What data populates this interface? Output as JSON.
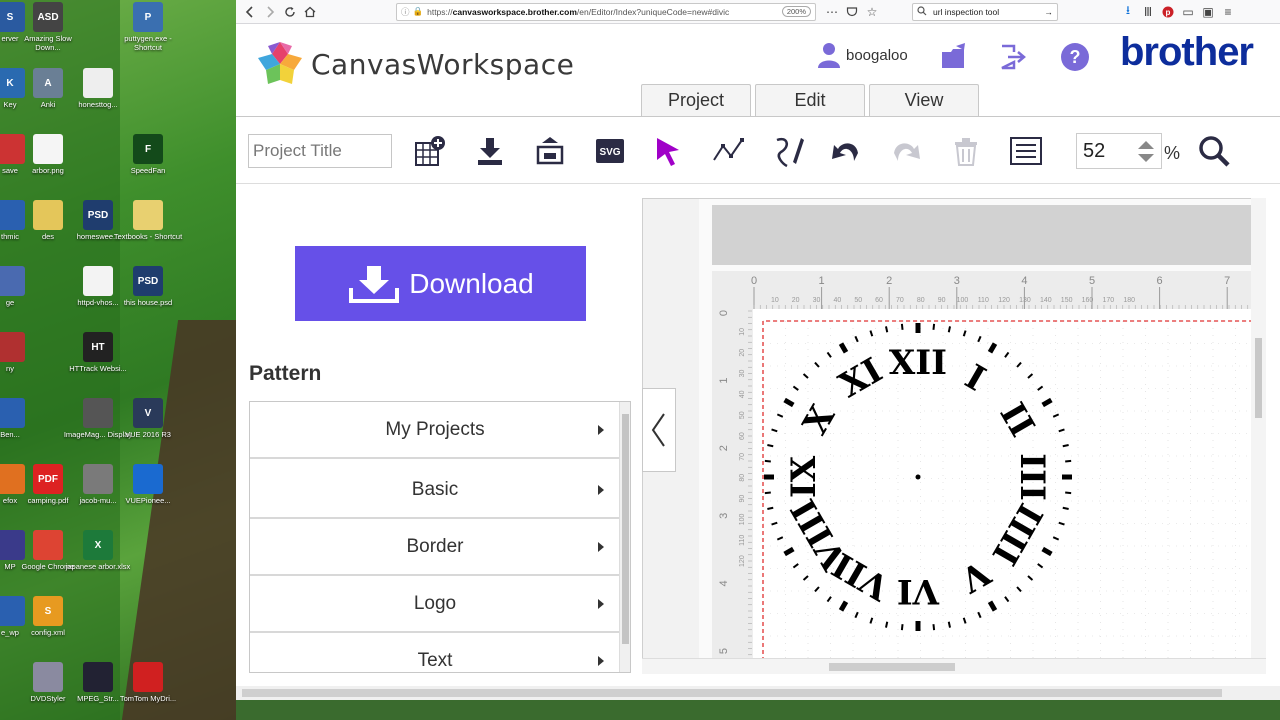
{
  "desktop": {
    "icons": [
      {
        "label": "erver",
        "color": "#2a5aa0",
        "glyph": "S"
      },
      {
        "label": "Amazing Slow Down...",
        "color": "#444",
        "glyph": "ASD"
      },
      {
        "label": "puttygen.exe - Shortcut",
        "color": "#3a6fb0",
        "glyph": "P"
      },
      {
        "label": "Key",
        "color": "#2a6ab0",
        "glyph": "K"
      },
      {
        "label": "Anki",
        "color": "#6a7f95",
        "glyph": "A"
      },
      {
        "label": "honesttog...",
        "color": "#eee",
        "glyph": ""
      },
      {
        "label": "save",
        "color": "#c33",
        "glyph": ""
      },
      {
        "label": "arbor.png",
        "color": "#f5f5f5",
        "glyph": ""
      },
      {
        "label": "SpeedFan",
        "color": "#134a1a",
        "glyph": "F"
      },
      {
        "label": "thmic",
        "color": "#2a60b0",
        "glyph": ""
      },
      {
        "label": "des",
        "color": "#e4c65a",
        "glyph": ""
      },
      {
        "label": "homeswee...",
        "color": "#1f3d6e",
        "glyph": "PSD"
      },
      {
        "label": "Textbooks - Shortcut",
        "color": "#e8d070",
        "glyph": ""
      },
      {
        "label": "ge",
        "color": "#4a6ab0",
        "glyph": ""
      },
      {
        "label": "httpd-vhos...",
        "color": "#f3f3f3",
        "glyph": ""
      },
      {
        "label": "this house.psd",
        "color": "#1f3d6e",
        "glyph": "PSD"
      },
      {
        "label": "ny",
        "color": "#b03030",
        "glyph": ""
      },
      {
        "label": "HTTrack Websi...",
        "color": "#222",
        "glyph": "HT"
      },
      {
        "label": "Ben...",
        "color": "#2a60b0",
        "glyph": ""
      },
      {
        "label": "ImageMag... Display",
        "color": "#555",
        "glyph": ""
      },
      {
        "label": "VUE 2016 R3",
        "color": "#2a3a5a",
        "glyph": "V"
      },
      {
        "label": "efox",
        "color": "#e07020",
        "glyph": ""
      },
      {
        "label": "camping.pdf",
        "color": "#d22",
        "glyph": "PDF"
      },
      {
        "label": "jacob-mu...",
        "color": "#7a7a7a",
        "glyph": ""
      },
      {
        "label": "VUEPionee...",
        "color": "#1a6ad0",
        "glyph": ""
      },
      {
        "label": "MP",
        "color": "#3a3a8a",
        "glyph": ""
      },
      {
        "label": "Google Chrome",
        "color": "#dd4433",
        "glyph": ""
      },
      {
        "label": "japanese arbor.xlsx",
        "color": "#1d7a3a",
        "glyph": "X"
      },
      {
        "label": "e_wp",
        "color": "#2a60b0",
        "glyph": ""
      },
      {
        "label": "config.xml",
        "color": "#e79a20",
        "glyph": "S"
      },
      {
        "label": "DVDStyler",
        "color": "#8a8aa0",
        "glyph": ""
      },
      {
        "label": "MPEG_Str...",
        "color": "#223",
        "glyph": ""
      },
      {
        "label": "TomTom MyDri...",
        "color": "#d02020",
        "glyph": ""
      }
    ]
  },
  "browser": {
    "url_prefix": "https://",
    "url_domain": "canvasworkspace.brother.com",
    "url_rest": "/en/Editor/Index?uniqueCode=new#divic",
    "zoom": "200%",
    "search_text": "url inspection tool"
  },
  "app": {
    "logo_text": "CanvasWorkspace",
    "username": "boogaloo",
    "brand": "brother",
    "menu_tabs": [
      "Project",
      "Edit",
      "View"
    ],
    "project_title_placeholder": "Project Title",
    "zoom_value": "52",
    "zoom_unit": "%",
    "download_label": "Download",
    "pattern_heading": "Pattern",
    "pattern_items": [
      "My Projects",
      "Basic",
      "Border",
      "Logo",
      "Text"
    ]
  },
  "canvas": {
    "ruler_top_major": [
      "0",
      "1",
      "2",
      "3",
      "4",
      "5",
      "6",
      "7"
    ],
    "ruler_top_minor": [
      "10",
      "20",
      "30",
      "40",
      "50",
      "60",
      "70",
      "80",
      "90",
      "100",
      "110",
      "120",
      "130",
      "140",
      "150",
      "160",
      "170",
      "180"
    ],
    "ruler_left_major": [
      "0",
      "1",
      "2",
      "3",
      "4",
      "5"
    ],
    "ruler_left_minor": [
      "10",
      "20",
      "30",
      "40",
      "50",
      "60",
      "70",
      "80",
      "90",
      "100",
      "110",
      "120"
    ],
    "clock_numerals": [
      "XII",
      "I",
      "II",
      "III",
      "IIII",
      "V",
      "VI",
      "VII",
      "VIII",
      "IX",
      "X",
      "XI"
    ],
    "accent_color": "#a000c8",
    "cut_line_color": "#e03030"
  }
}
